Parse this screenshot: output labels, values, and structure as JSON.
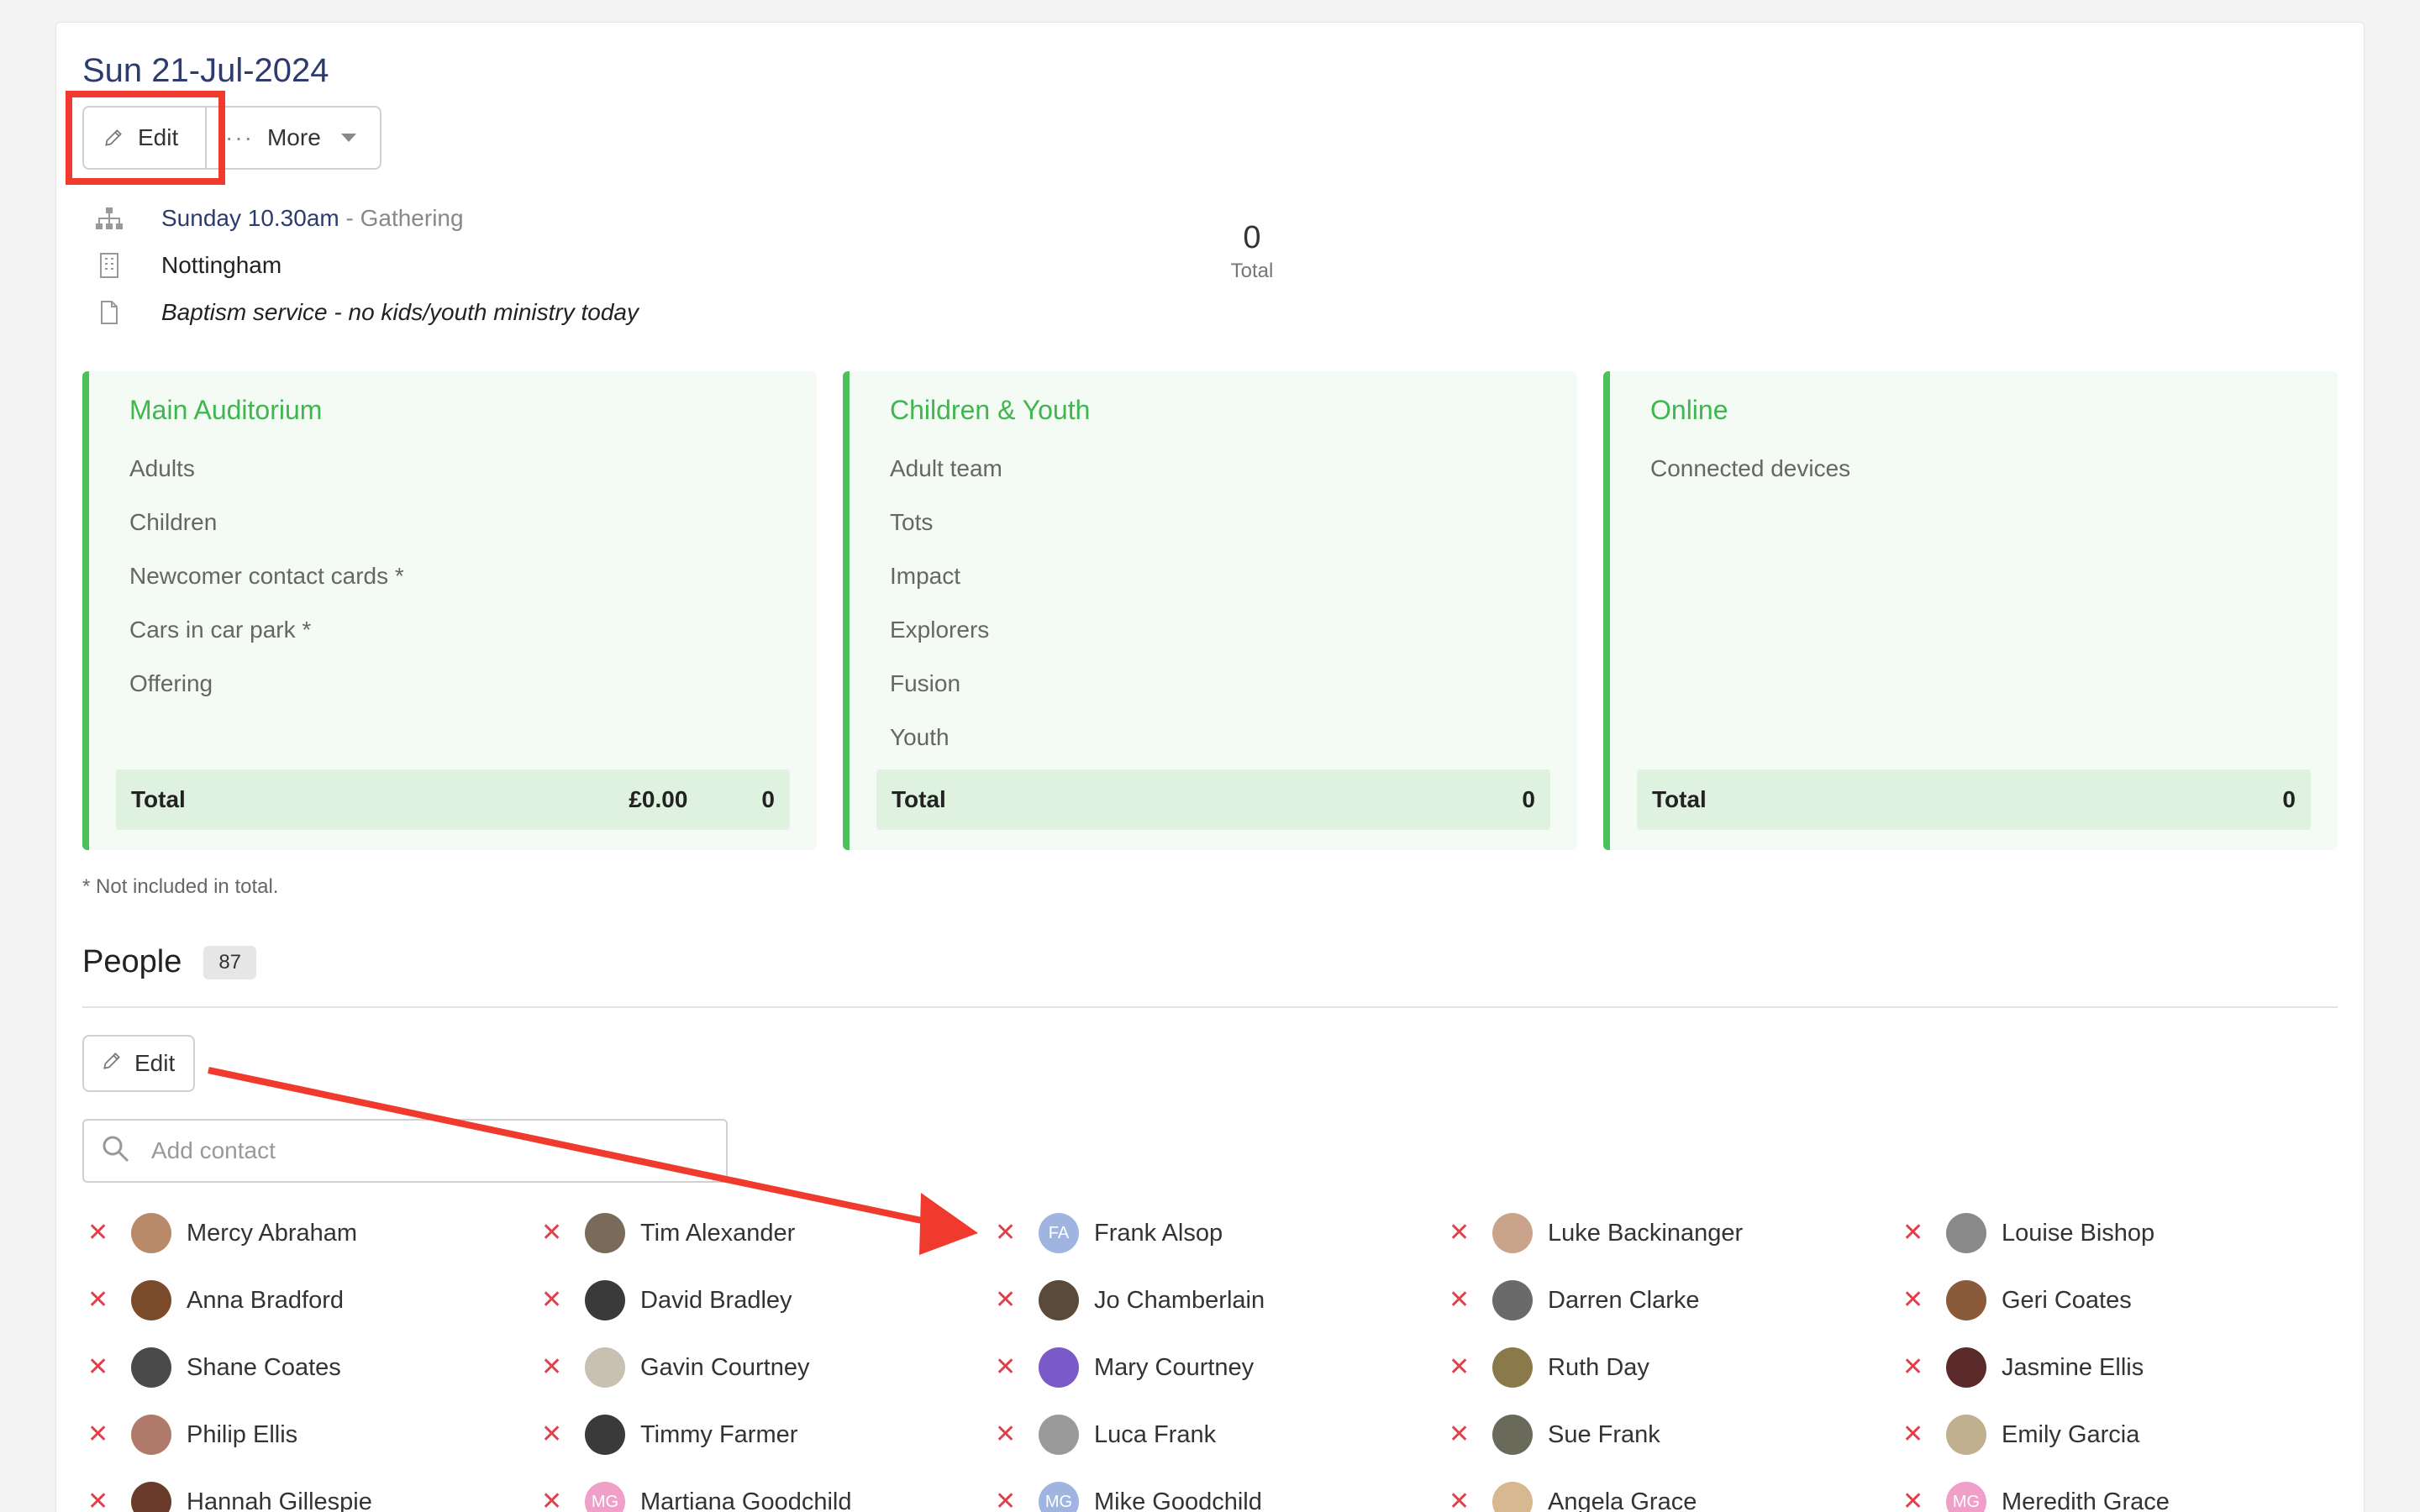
{
  "header": {
    "title": "Sun 21-Jul-2024",
    "edit_label": "Edit",
    "more_label": "More",
    "more_icon": "ellipsis-icon"
  },
  "details": {
    "service": "Sunday 10.30am",
    "service_type": "- Gathering",
    "location": "Nottingham",
    "note": "Baptism service - no kids/youth ministry today"
  },
  "summary": {
    "total_value": "0",
    "total_label": "Total"
  },
  "panels": [
    {
      "title": "Main Auditorium",
      "rows": [
        "Adults",
        "Children",
        "Newcomer contact cards *",
        "Cars in car park *",
        "Offering"
      ],
      "total_label": "Total",
      "total_money": "£0.00",
      "total_count": "0"
    },
    {
      "title": "Children & Youth",
      "rows": [
        "Adult team",
        "Tots",
        "Impact",
        "Explorers",
        "Fusion",
        "Youth"
      ],
      "total_label": "Total",
      "total_money": "",
      "total_count": "0"
    },
    {
      "title": "Online",
      "rows": [
        "Connected devices"
      ],
      "total_label": "Total",
      "total_money": "",
      "total_count": "0"
    }
  ],
  "footnote": "* Not included in total.",
  "people": {
    "heading": "People",
    "count": "87",
    "edit_label": "Edit",
    "search_placeholder": "Add contact",
    "list": [
      {
        "name": "Mercy Abraham",
        "initials": "",
        "color": "#b98a6a"
      },
      {
        "name": "Tim Alexander",
        "initials": "",
        "color": "#7a6a5a"
      },
      {
        "name": "Frank Alsop",
        "initials": "FA",
        "color": "#9fb4e0"
      },
      {
        "name": "Luke Backinanger",
        "initials": "",
        "color": "#c9a48a"
      },
      {
        "name": "Louise Bishop",
        "initials": "",
        "color": "#8a8a8a"
      },
      {
        "name": "Anna Bradford",
        "initials": "",
        "color": "#7a4a2a"
      },
      {
        "name": "David Bradley",
        "initials": "",
        "color": "#3a3a3a"
      },
      {
        "name": "Jo Chamberlain",
        "initials": "",
        "color": "#5a4a3a"
      },
      {
        "name": "Darren Clarke",
        "initials": "",
        "color": "#6a6a6a"
      },
      {
        "name": "Geri Coates",
        "initials": "",
        "color": "#8a5a3a"
      },
      {
        "name": "Shane Coates",
        "initials": "",
        "color": "#4a4a4a"
      },
      {
        "name": "Gavin Courtney",
        "initials": "",
        "color": "#c8c0b0"
      },
      {
        "name": "Mary Courtney",
        "initials": "",
        "color": "#7a5ac8"
      },
      {
        "name": "Ruth Day",
        "initials": "",
        "color": "#8a7a4a"
      },
      {
        "name": "Jasmine Ellis",
        "initials": "",
        "color": "#5a2a2a"
      },
      {
        "name": "Philip Ellis",
        "initials": "",
        "color": "#b07a6a"
      },
      {
        "name": "Timmy Farmer",
        "initials": "",
        "color": "#3a3a3a"
      },
      {
        "name": "Luca Frank",
        "initials": "",
        "color": "#9a9a9a"
      },
      {
        "name": "Sue Frank",
        "initials": "",
        "color": "#6a6a5a"
      },
      {
        "name": "Emily Garcia",
        "initials": "",
        "color": "#c0b090"
      },
      {
        "name": "Hannah Gillespie",
        "initials": "",
        "color": "#6a3a2a"
      },
      {
        "name": "Martiana Goodchild",
        "initials": "MG",
        "color": "#f0a0c8"
      },
      {
        "name": "Mike Goodchild",
        "initials": "MG",
        "color": "#9fb4e0"
      },
      {
        "name": "Angela Grace",
        "initials": "",
        "color": "#d8b890"
      },
      {
        "name": "Meredith Grace",
        "initials": "MG",
        "color": "#f0a0c8"
      }
    ]
  },
  "colors": {
    "accent_green": "#4cc15a",
    "title_blue": "#2d3b6e",
    "annotation_red": "#f03a2e"
  }
}
